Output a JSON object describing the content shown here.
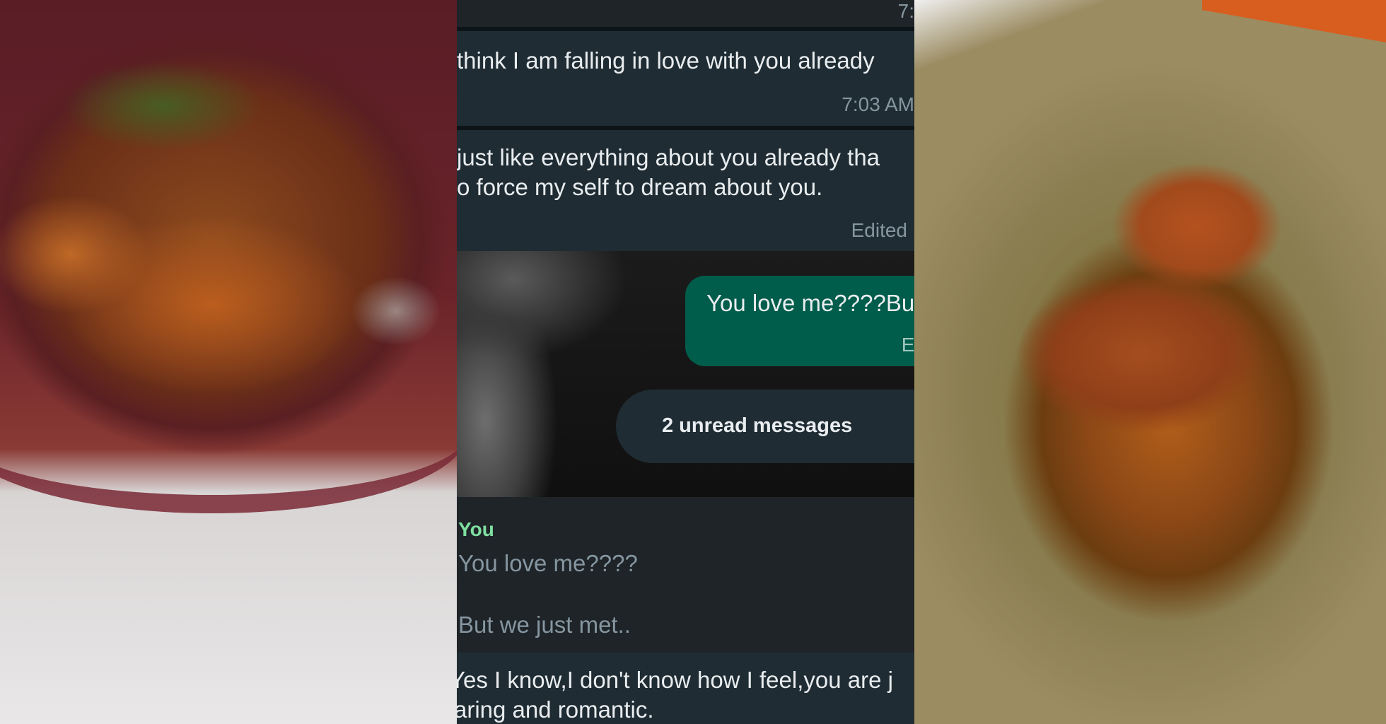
{
  "chat": {
    "top_time": "7:",
    "msg1": {
      "text": "think I am falling in love with you already",
      "time": "7:03 AM"
    },
    "msg2": {
      "line1": "just like everything about you already tha",
      "line2": "o force my self to dream about you.",
      "edited": "Edited"
    },
    "outgoing": {
      "text": "You love me????Bu",
      "edited": "Ed"
    },
    "unread_label": "2 unread messages",
    "quote": {
      "author": "You",
      "line1": "You love me????",
      "line2": "But we just met.."
    },
    "msg3": {
      "line1": "Yes I know,I don't know how I feel,you are j",
      "line2": "aring and romantic."
    },
    "colors": {
      "outgoing_bubble": "#005c4b",
      "incoming_bubble": "#1f2c33",
      "quote_author": "#7fe0a0"
    }
  }
}
